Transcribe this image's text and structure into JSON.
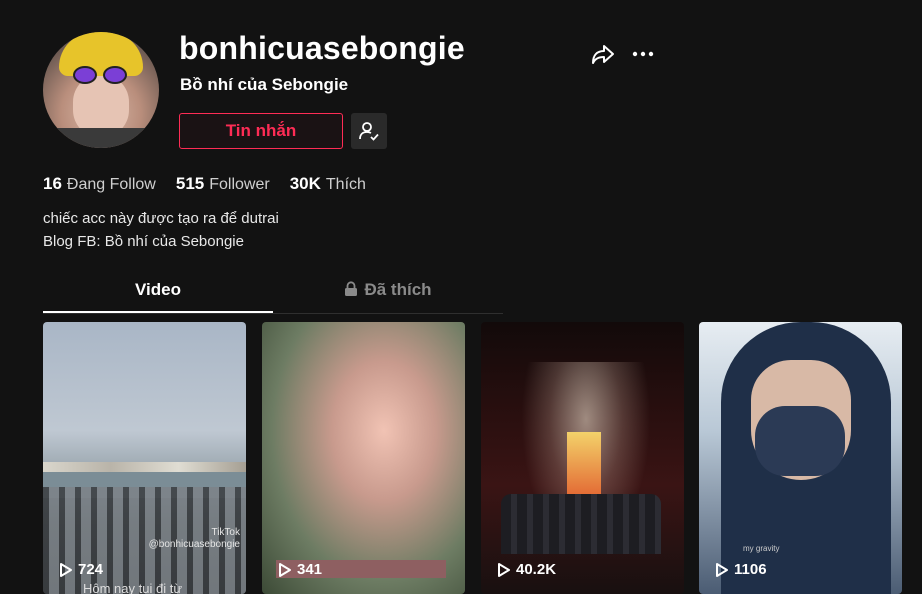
{
  "profile": {
    "username": "bonhicuasebongie",
    "nickname": "Bồ nhí của Sebongie",
    "message_label": "Tin nhắn",
    "stats": [
      {
        "value": "16",
        "label": "Đang Follow"
      },
      {
        "value": "515",
        "label": "Follower"
      },
      {
        "value": "30K",
        "label": "Thích"
      }
    ],
    "bio_lines": [
      "chiếc acc này được tạo ra để dutrai",
      "Blog FB: Bồ nhí của Sebongie"
    ]
  },
  "tabs": [
    {
      "label": "Video",
      "active": true
    },
    {
      "label": "Đã thích",
      "active": false,
      "locked": true
    }
  ],
  "videos": [
    {
      "views": "724",
      "caption": "Hôm nay tui đi từ",
      "watermark": "TikTok",
      "handle": "@bonhicuasebongie"
    },
    {
      "views": "341"
    },
    {
      "views": "40.2K"
    },
    {
      "views": "1106",
      "overlay_text": "my gravity"
    }
  ],
  "colors": {
    "accent": "#fe2c55",
    "background": "#121212"
  }
}
